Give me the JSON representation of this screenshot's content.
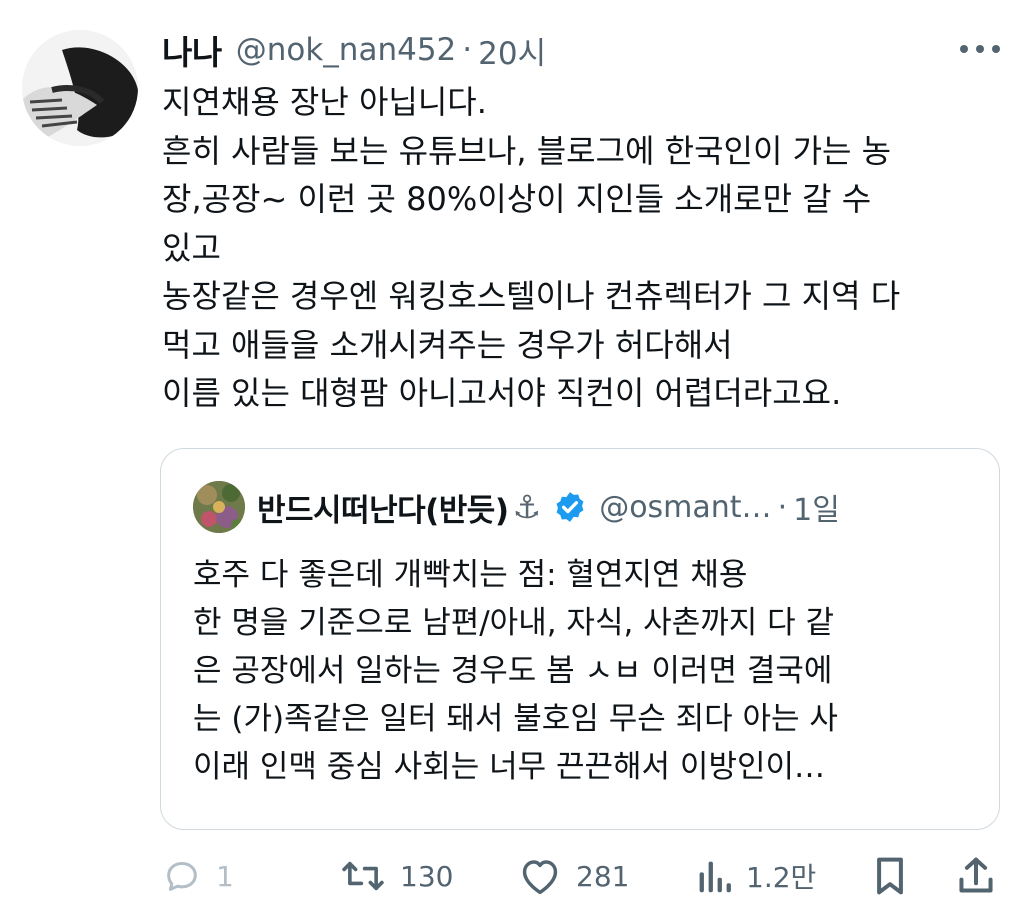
{
  "tweet": {
    "author_name": "나나",
    "handle": "@nok_nan452",
    "separator": "·",
    "time": "20시",
    "lines": [
      "지연채용 장난 아닙니다.",
      "흔히 사람들 보는 유튜브나, 블로그에 한국인이 가는 농",
      "장,공장~ 이런 곳 80%이상이 지인들 소개로만 갈 수",
      "있고",
      "농장같은 경우엔 워킹호스텔이나 컨츄렉터가 그 지역 다",
      "먹고 애들을 소개시켜주는 경우가 허다해서",
      "이름 있는 대형팜 아니고서야 직컨이 어렵더라고요."
    ]
  },
  "quote": {
    "author_name": "반드시떠난다(반듯)",
    "anchor_emoji": "⚓",
    "handle": "@osmant…",
    "separator": "·",
    "time": "1일",
    "lines": [
      "호주 다 좋은데 개빡치는 점: 혈연지연 채용",
      "한 명을 기준으로 남편/아내, 자식, 사촌까지 다 같",
      "은 공장에서 일하는 경우도 봄 ㅅㅂ 이러면 결국에",
      "는 (가)족같은 일터 돼서 불호임 무슨 죄다 아는 사",
      "이래 인맥 중심 사회는 너무 끈끈해서 이방인이…"
    ]
  },
  "actions": {
    "reply_count": "1",
    "retweet_count": "130",
    "like_count": "281",
    "views_count": "1.2만"
  },
  "icons": {
    "reply": "reply-icon",
    "retweet": "retweet-icon",
    "like": "heart-icon",
    "views": "views-icon",
    "bookmark": "bookmark-icon",
    "share": "share-icon",
    "more": "more-icon",
    "verified": "verified-badge-icon"
  },
  "colors": {
    "text": "#0f1419",
    "secondary": "#536471",
    "border": "#cfd9de",
    "verified": "#1d9bf0"
  }
}
